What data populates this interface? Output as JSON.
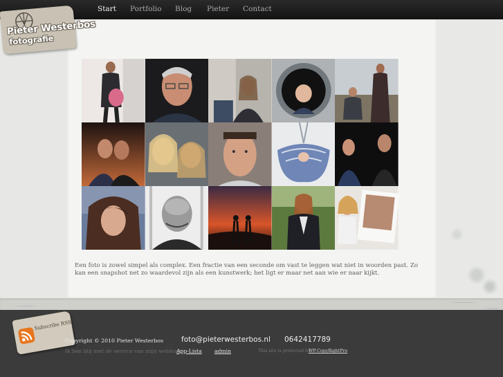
{
  "nav": {
    "items": [
      {
        "label": "Start",
        "active": true
      },
      {
        "label": "Portfolio",
        "active": false
      },
      {
        "label": "Blog",
        "active": false
      },
      {
        "label": "Pieter",
        "active": false
      },
      {
        "label": "Contact",
        "active": false
      }
    ]
  },
  "logo": {
    "line1": "Pieter Westerbos",
    "line2": "fotografie"
  },
  "gallery": {
    "photos": [
      {
        "subject": "pregnant-woman-in-doorway"
      },
      {
        "subject": "portrait-man-with-glasses"
      },
      {
        "subject": "woman-on-couch"
      },
      {
        "subject": "toddler-in-washing-machine"
      },
      {
        "subject": "pregnant-woman-and-man-on-balcony"
      },
      {
        "subject": "couple-at-sunset"
      },
      {
        "subject": "two-blonde-girls"
      },
      {
        "subject": "young-man-portrait"
      },
      {
        "subject": "baby-in-cloth-sling"
      },
      {
        "subject": "two-young-men-dark"
      },
      {
        "subject": "woman-with-long-hair"
      },
      {
        "subject": "bald-older-man-bw"
      },
      {
        "subject": "couple-silhouette-sunset-sky"
      },
      {
        "subject": "pregnant-woman-in-blazer"
      },
      {
        "subject": "girls-with-polaroid"
      }
    ]
  },
  "intro_text": "Een foto is zowel simpel als complex. Een fractie van een seconde om vast te leggen wat niet in woorden past. Zo kan een snapshot net zo waardevol zijn als een kunstwerk; het ligt er maar net aan wie er naar kijkt.",
  "footer": {
    "rss_label": "Subscribe RSS",
    "copyright": "Copyright © 2010 Pieter Westerbos",
    "email": "foto@pieterwesterbos.nl",
    "phone": "0642417789",
    "service_text": "Ik ben blij met de service van mijn webhost:",
    "service_link": "App-Lista",
    "admin_link": "admin",
    "protected_text": "This site is protected by",
    "protected_link": "WP-CopyRightPro"
  },
  "colors": {
    "topbar": "#1c1c1c",
    "footer": "#3b3b3b",
    "rss": "#e8761e",
    "panel": "#f4f5f2"
  }
}
